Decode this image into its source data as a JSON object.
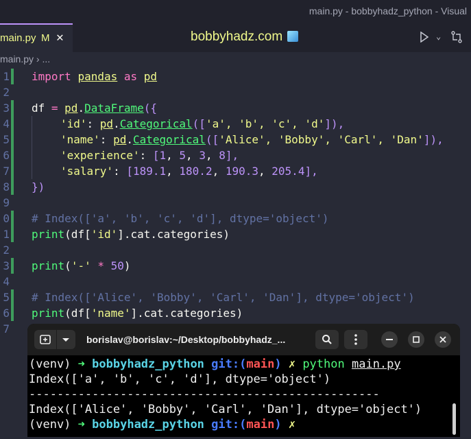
{
  "window": {
    "title": "main.py - bobbyhadz_python - Visual"
  },
  "tab": {
    "filename": "main.py",
    "modified_badge": "M",
    "close_glyph": "✕"
  },
  "header": {
    "center_title": "bobbyhadz.com"
  },
  "breadcrumb": {
    "file": "main.py",
    "sep": " › ",
    "more": "..."
  },
  "gutter": {
    "line_numbers": [
      "1",
      "2",
      "3",
      "4",
      "5",
      "6",
      "7",
      "8",
      "9",
      "0",
      "1",
      "2",
      "3",
      "4",
      "5",
      "6",
      "7"
    ]
  },
  "code": {
    "l1": {
      "kw1": "import",
      "mod": "pandas",
      "kw2": "as",
      "alias": "pd"
    },
    "l3": {
      "var": "df",
      "eq": " = ",
      "mod": "pd",
      "dot": ".",
      "fn": "DataFrame",
      "open": "({"
    },
    "l4": {
      "key": "'id'",
      "colon": ": ",
      "mod": "pd",
      "dot": ".",
      "fn": "Categorical",
      "open": "([",
      "items": "'a', 'b', 'c', 'd'",
      "close": "]),"
    },
    "l5": {
      "key": "'name'",
      "colon": ": ",
      "mod": "pd",
      "dot": ".",
      "fn": "Categorical",
      "open": "([",
      "items": "'Alice', 'Bobby', 'Carl', 'Dan'",
      "close": "]),"
    },
    "l6": {
      "key": "'experience'",
      "colon": ": ",
      "open": "[",
      "n1": "1",
      "n2": "5",
      "n3": "3",
      "n4": "8",
      "close": "],",
      "sep": ", "
    },
    "l7": {
      "key": "'salary'",
      "colon": ": ",
      "open": "[",
      "n1": "189.1",
      "n2": "180.2",
      "n3": "190.3",
      "n4": "205.4",
      "close": "],",
      "sep": ", "
    },
    "l8": {
      "close": "})"
    },
    "l10": {
      "comment": "# Index(['a', 'b', 'c', 'd'], dtype='object')"
    },
    "l11": {
      "fn": "print",
      "open": "(df[",
      "str": "'id'",
      "close": "].cat.categories)"
    },
    "l13": {
      "fn": "print",
      "open": "(",
      "str": "'-'",
      "op": " * ",
      "num": "50",
      "close": ")"
    },
    "l15": {
      "comment": "# Index(['Alice', 'Bobby', 'Carl', 'Dan'], dtype='object')"
    },
    "l16": {
      "fn": "print",
      "open": "(df[",
      "str": "'name'",
      "close": "].cat.categories)"
    }
  },
  "terminal": {
    "title": "borislav@borislav:~/Desktop/bobbyhadz_...",
    "icons": {
      "new_tab": "new-tab-icon",
      "dropdown": "chevron-down-icon",
      "search": "search-icon",
      "menu": "kebab-menu-icon",
      "minimize": "minimize-icon",
      "maximize": "maximize-icon",
      "close": "close-icon"
    },
    "prompt": {
      "venv": "(venv) ",
      "arrow": "➜",
      "dir": "bobbyhadz_python",
      "git_open": "git:(",
      "branch": "main",
      "git_close": ")",
      "x": "✗"
    },
    "command": "python",
    "arg": "main.py",
    "output": [
      "Index(['a', 'b', 'c', 'd'], dtype='object')",
      "--------------------------------------------------",
      "Index(['Alice', 'Bobby', 'Carl', 'Dan'], dtype='object')"
    ]
  }
}
